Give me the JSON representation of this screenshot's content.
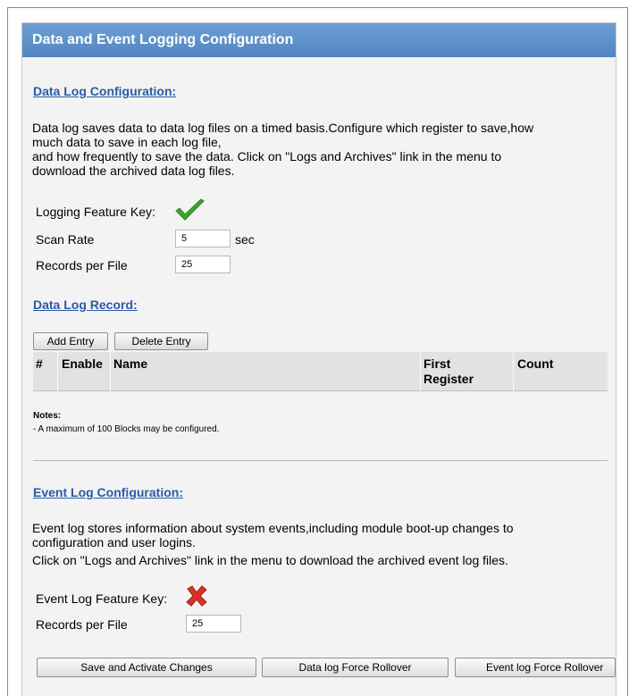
{
  "panel": {
    "title": "Data and Event Logging Configuration"
  },
  "data_log": {
    "section_title": "Data Log Configuration:",
    "description_1": "Data log saves data to data log files on a timed basis.Configure which register to save,how",
    "description_2": "much data to save in each log file,",
    "description_3": "and how frequently to save the data. Click on \"Logs and Archives\" link in the menu to",
    "description_4": "download the archived data log files.",
    "feature_key_label": "Logging Feature Key:",
    "feature_key_icon": "check-icon",
    "scan_rate_label": "Scan Rate",
    "scan_rate_value": "5",
    "scan_rate_unit": "sec",
    "records_label": "Records per File",
    "records_value": "25"
  },
  "record": {
    "section_title": "Data Log Record:",
    "add_label": "Add Entry",
    "delete_label": "Delete Entry",
    "columns": {
      "num": "#",
      "enable": "Enable",
      "name": "Name",
      "first_register_1": "First",
      "first_register_2": "Register",
      "count": "Count"
    },
    "notes_title": "Notes:",
    "notes_line": " - A maximum of 100 Blocks may be configured."
  },
  "event_log": {
    "section_title": "Event Log Configuration:",
    "description_1": "Event log stores information about system events,including module boot-up changes to",
    "description_2": "configuration and user logins.",
    "description_3": "Click on \"Logs and Archives\" link in the menu to download the archived event log files.",
    "feature_key_label": "Event Log Feature Key:",
    "feature_key_icon": "cross-icon",
    "records_label": "Records per File",
    "records_value": "25"
  },
  "actions": {
    "save_label": "Save and Activate Changes",
    "data_rollover_label": "Data log Force Rollover",
    "event_rollover_label": "Event log Force Rollover"
  },
  "colors": {
    "header": "#5b8fc7",
    "link": "#2a5ba8",
    "check": "#3aa82c",
    "cross": "#d8322a"
  }
}
